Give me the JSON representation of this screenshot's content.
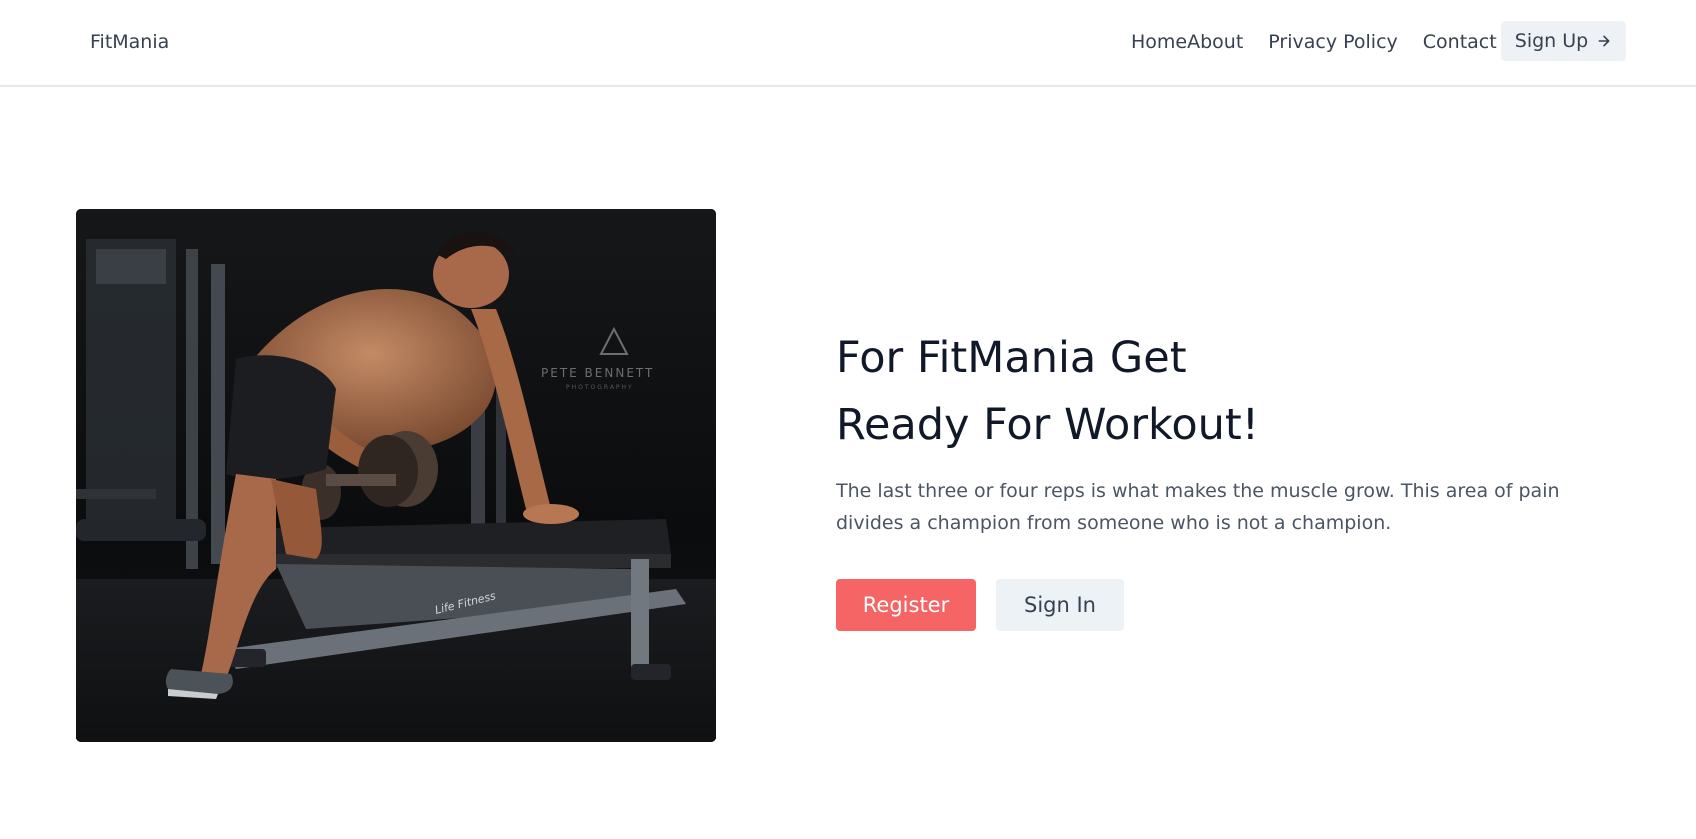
{
  "header": {
    "brand": "FitMania",
    "nav": [
      "Home",
      "About",
      "Privacy Policy",
      "Contact"
    ],
    "signup_label": "Sign Up",
    "signup_icon": "arrow-right-icon"
  },
  "hero": {
    "image_alt": "man doing dumbbell row on bench",
    "image_watermark": "PETE BENNETT PHOTOGRAPHY",
    "title_line1": "For FitMania Get",
    "title_line2": "Ready For Workout!",
    "description": "The last three or four reps is what makes the muscle grow. This area of pain divides a champion from someone who is not a champion.",
    "register_label": "Register",
    "signin_label": "Sign In"
  },
  "colors": {
    "accent": "#f56565",
    "secondary_button": "#edf2f7",
    "heading": "#111827",
    "body_text": "#4b5563"
  }
}
